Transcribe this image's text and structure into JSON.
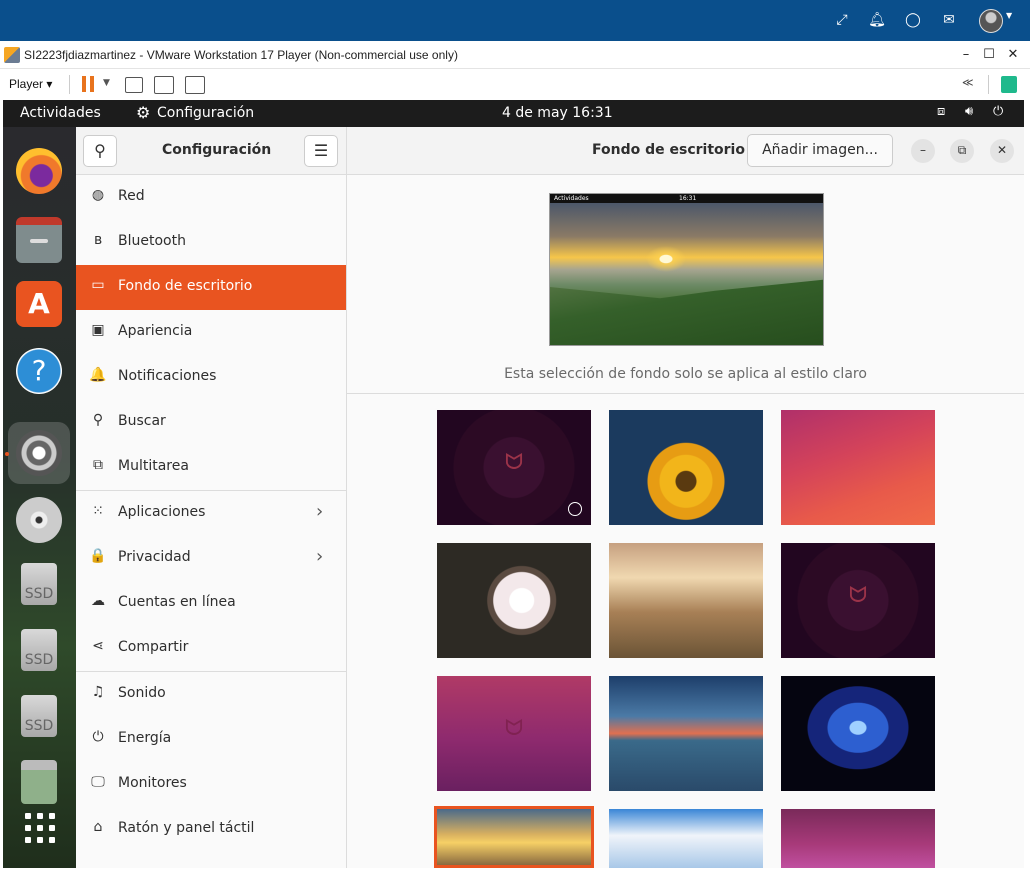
{
  "vmware": {
    "title": "SI2223fjdiazmartinez - VMware Workstation 17 Player (Non-commercial use only)",
    "player_label": "Player",
    "minimize": "–",
    "maximize": "☐",
    "close": "✕"
  },
  "gnome_bar": {
    "activities": "Actividades",
    "app_name": "Configuración",
    "clock": "4 de may  16:31"
  },
  "settings": {
    "sidebar_title": "Configuración",
    "header_title": "Fondo de escritorio",
    "add_image_label": "Añadir imagen...",
    "items": [
      {
        "label": "Red",
        "icon": "globe-icon",
        "glyph": "◍"
      },
      {
        "label": "Bluetooth",
        "icon": "bluetooth-icon",
        "glyph": "ʙ"
      },
      {
        "label": "Fondo de escritorio",
        "icon": "wallpaper-icon",
        "glyph": "▭"
      },
      {
        "label": "Apariencia",
        "icon": "appearance-icon",
        "glyph": "▣"
      },
      {
        "label": "Notificaciones",
        "icon": "bell-icon",
        "glyph": "🔔"
      },
      {
        "label": "Buscar",
        "icon": "search-icon",
        "glyph": "⚲"
      },
      {
        "label": "Multitarea",
        "icon": "multitask-icon",
        "glyph": "⧉"
      },
      {
        "label": "Aplicaciones",
        "icon": "apps-grid-icon",
        "glyph": "⁙"
      },
      {
        "label": "Privacidad",
        "icon": "lock-icon",
        "glyph": "🔒"
      },
      {
        "label": "Cuentas en línea",
        "icon": "cloud-icon",
        "glyph": "☁"
      },
      {
        "label": "Compartir",
        "icon": "share-icon",
        "glyph": "⋖"
      },
      {
        "label": "Sonido",
        "icon": "music-icon",
        "glyph": "♫"
      },
      {
        "label": "Energía",
        "icon": "power-icon",
        "glyph": "⏻"
      },
      {
        "label": "Monitores",
        "icon": "monitor-icon",
        "glyph": "🖵"
      },
      {
        "label": "Ratón y panel táctil",
        "icon": "mouse-icon",
        "glyph": "⌂"
      }
    ],
    "active_item": "Fondo de escritorio",
    "preview": {
      "bar_left": "Actividades",
      "bar_clock": "16:31"
    },
    "note": "Esta selección de fondo solo se aplica al estilo claro"
  },
  "dock": {
    "ssd_label": "SSD"
  },
  "colors": {
    "accent": "#e95420",
    "host_bar": "#0a4f8c",
    "gnome_bar": "#1c1c1c"
  }
}
